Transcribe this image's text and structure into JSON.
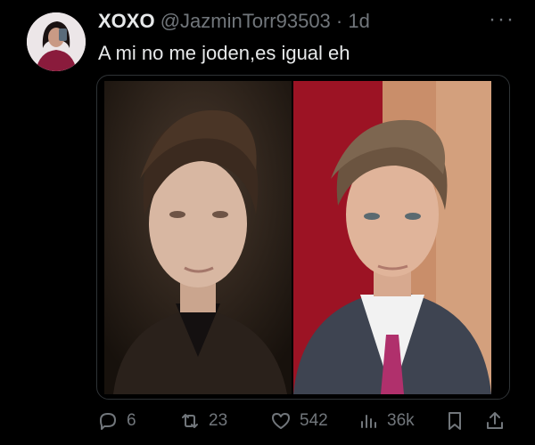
{
  "tweet": {
    "display_name": "XOXO",
    "handle": "@JazminTorr93503",
    "separator": "·",
    "time": "1d",
    "text": "A mi no me joden,es igual eh",
    "more_label": "···"
  },
  "media": {
    "images": [
      "left-portrait-photo",
      "right-portrait-photo"
    ]
  },
  "actions": {
    "replies": "6",
    "reposts": "23",
    "likes": "542",
    "views": "36k"
  },
  "colors": {
    "background": "#000000",
    "text": "#e7e9ea",
    "muted": "#71767b",
    "border": "#2f3336"
  }
}
